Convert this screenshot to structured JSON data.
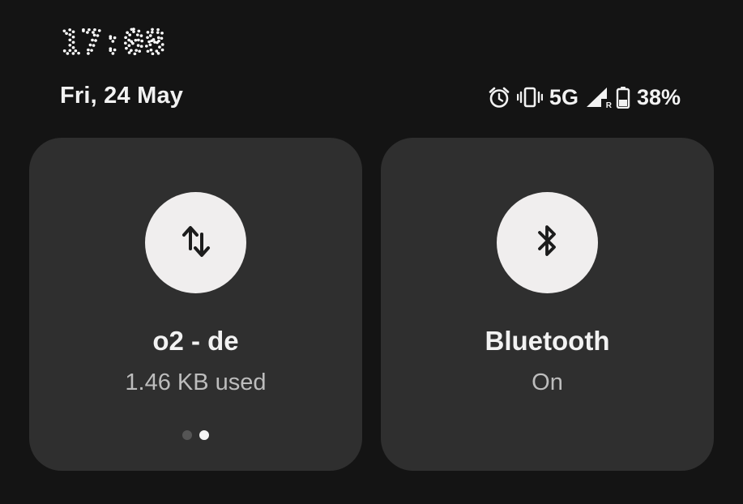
{
  "header": {
    "time": "17:08",
    "date": "Fri, 24 May"
  },
  "status": {
    "alarm_icon": "alarm-clock-icon",
    "vibrate_icon": "vibrate-icon",
    "network_type": "5G",
    "signal_icon": "cell-signal-roaming-icon",
    "roaming_mark": "R",
    "battery_icon": "battery-icon",
    "battery_percent": "38%",
    "battery_level": 0.38
  },
  "tiles": [
    {
      "icon": "mobile-data-arrows-icon",
      "title": "o2 - de",
      "subtitle": "1.46 KB used",
      "page_dots": {
        "count": 2,
        "active_index": 1
      }
    },
    {
      "icon": "bluetooth-icon",
      "title": "Bluetooth",
      "subtitle": "On"
    }
  ],
  "colors": {
    "background": "#141414",
    "tile": "#2f2f2f",
    "circle": "#f0eeee",
    "text": "#f2f2f2",
    "subtext": "#bdbdbd"
  }
}
